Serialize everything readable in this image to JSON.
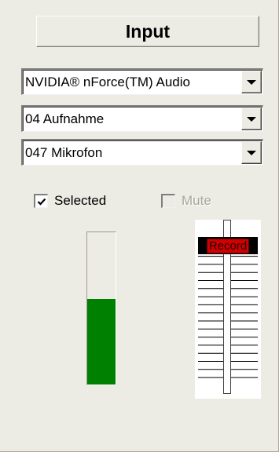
{
  "panel": {
    "title": "Input",
    "device_select": {
      "value": "NVIDIA® nForce(TM) Audio"
    },
    "line_select": {
      "value": "04 Aufnahme"
    },
    "source_select": {
      "value": "047 Mikrofon"
    },
    "selected_checkbox": {
      "label": "Selected",
      "checked": true
    },
    "mute_checkbox": {
      "label": "Mute",
      "checked": false,
      "disabled": true
    },
    "level_meter": {
      "level_fraction": 0.56,
      "color": "#008000"
    },
    "volume_slider": {
      "thumb_label": "Record",
      "thumb_color": "#d10000",
      "position_fraction": 0.11
    }
  }
}
